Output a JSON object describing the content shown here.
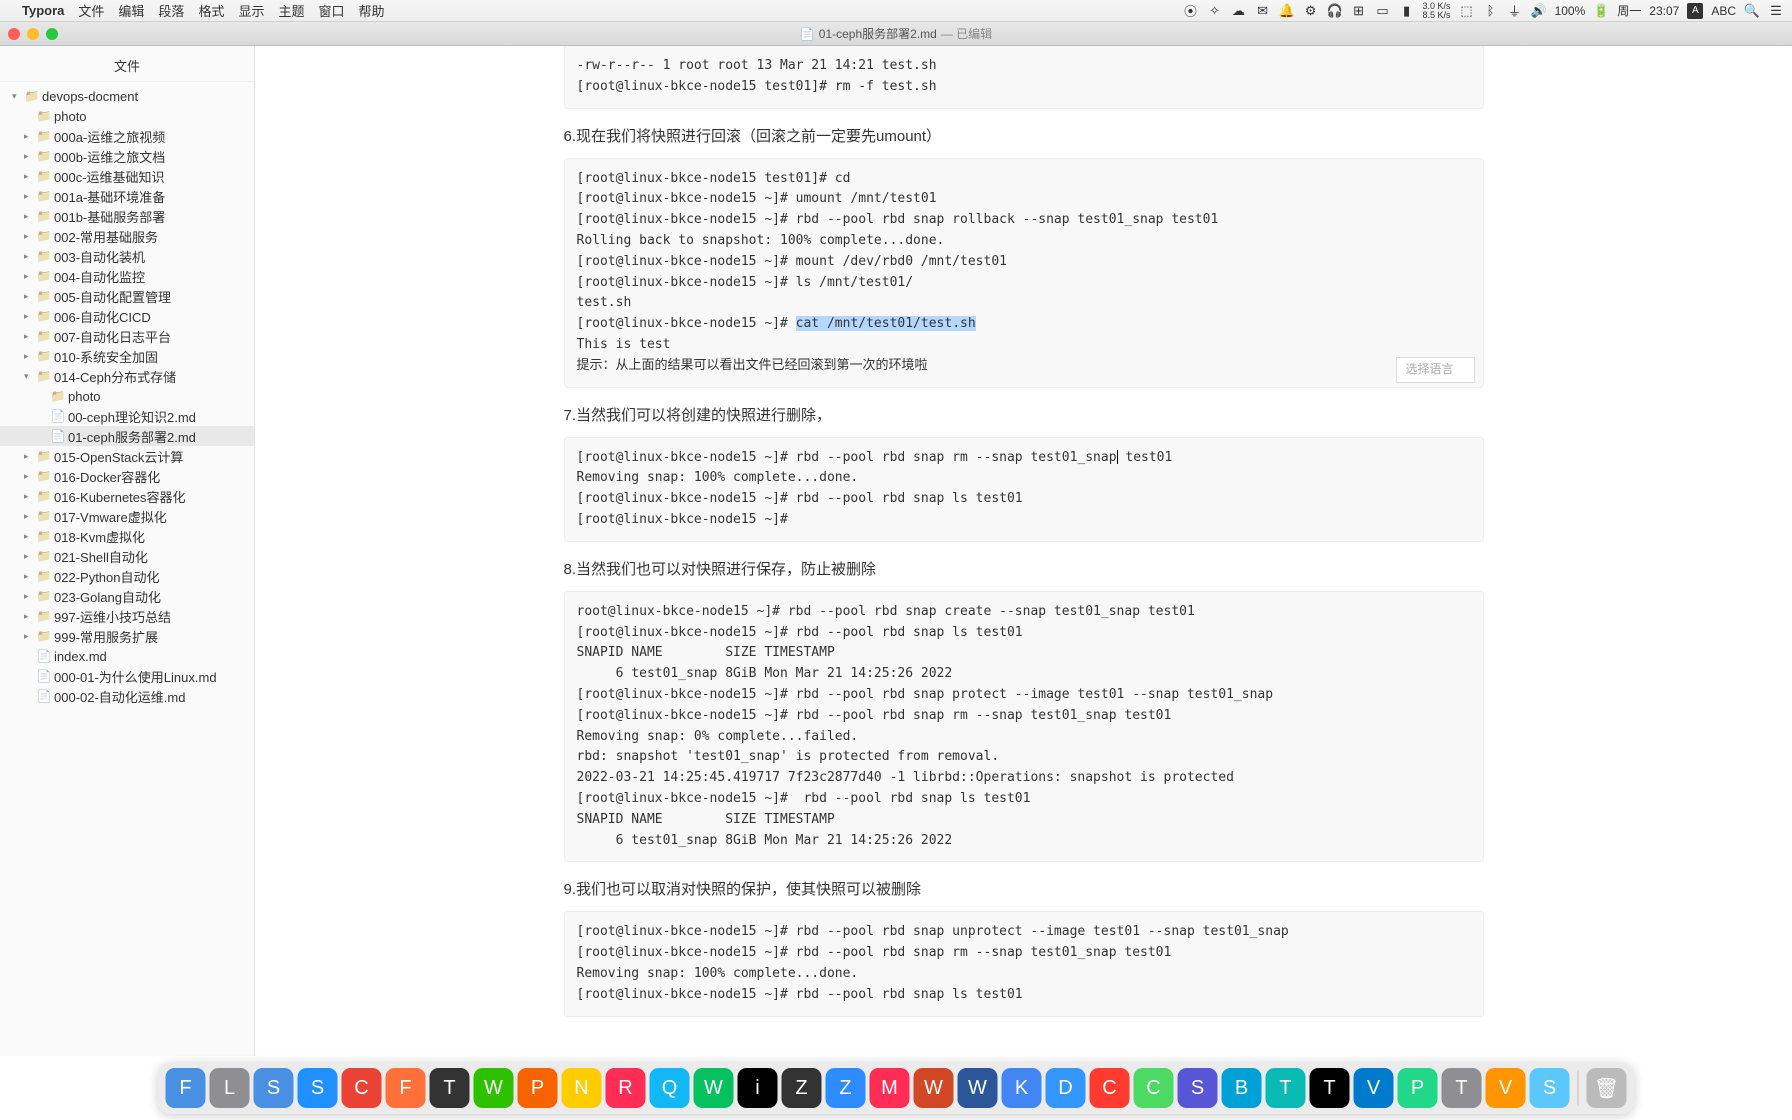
{
  "menubar": {
    "app": "Typora",
    "items": [
      "文件",
      "编辑",
      "段落",
      "格式",
      "显示",
      "主题",
      "窗口",
      "帮助"
    ],
    "right": {
      "net_up": "3.0 K/s",
      "net_dn": "8.5 K/s",
      "input": "A",
      "input2": "ABC",
      "battery": "100%",
      "day": "周一",
      "time": "23:07"
    }
  },
  "window": {
    "doc_title": "01-ceph服务部署2.md",
    "doc_status": "— 已编辑"
  },
  "sidebar": {
    "header": "文件",
    "root": "devops-docment",
    "items": [
      {
        "label": "photo",
        "type": "folder",
        "depth": 1,
        "expand": ""
      },
      {
        "label": "000a-运维之旅视频",
        "type": "folder",
        "depth": 1,
        "expand": "▸"
      },
      {
        "label": "000b-运维之旅文档",
        "type": "folder",
        "depth": 1,
        "expand": "▸"
      },
      {
        "label": "000c-运维基础知识",
        "type": "folder",
        "depth": 1,
        "expand": "▸"
      },
      {
        "label": "001a-基础环境准备",
        "type": "folder",
        "depth": 1,
        "expand": "▸"
      },
      {
        "label": "001b-基础服务部署",
        "type": "folder",
        "depth": 1,
        "expand": "▸"
      },
      {
        "label": "002-常用基础服务",
        "type": "folder",
        "depth": 1,
        "expand": "▸"
      },
      {
        "label": "003-自动化装机",
        "type": "folder",
        "depth": 1,
        "expand": "▸"
      },
      {
        "label": "004-自动化监控",
        "type": "folder",
        "depth": 1,
        "expand": "▸"
      },
      {
        "label": "005-自动化配置管理",
        "type": "folder",
        "depth": 1,
        "expand": "▸"
      },
      {
        "label": "006-自动化CICD",
        "type": "folder",
        "depth": 1,
        "expand": "▸"
      },
      {
        "label": "007-自动化日志平台",
        "type": "folder",
        "depth": 1,
        "expand": "▸"
      },
      {
        "label": "010-系统安全加固",
        "type": "folder",
        "depth": 1,
        "expand": "▸"
      },
      {
        "label": "014-Ceph分布式存储",
        "type": "folder",
        "depth": 1,
        "expand": "▾"
      },
      {
        "label": "photo",
        "type": "folder",
        "depth": 2,
        "expand": ""
      },
      {
        "label": "00-ceph理论知识2.md",
        "type": "file",
        "depth": 2
      },
      {
        "label": "01-ceph服务部署2.md",
        "type": "file",
        "depth": 2,
        "selected": true
      },
      {
        "label": "015-OpenStack云计算",
        "type": "folder",
        "depth": 1,
        "expand": "▸"
      },
      {
        "label": "016-Docker容器化",
        "type": "folder",
        "depth": 1,
        "expand": "▸"
      },
      {
        "label": "016-Kubernetes容器化",
        "type": "folder",
        "depth": 1,
        "expand": "▸"
      },
      {
        "label": "017-Vmware虚拟化",
        "type": "folder",
        "depth": 1,
        "expand": "▸"
      },
      {
        "label": "018-Kvm虚拟化",
        "type": "folder",
        "depth": 1,
        "expand": "▸"
      },
      {
        "label": "021-Shell自动化",
        "type": "folder",
        "depth": 1,
        "expand": "▸"
      },
      {
        "label": "022-Python自动化",
        "type": "folder",
        "depth": 1,
        "expand": "▸"
      },
      {
        "label": "023-Golang自动化",
        "type": "folder",
        "depth": 1,
        "expand": "▸"
      },
      {
        "label": "997-运维小技巧总结",
        "type": "folder",
        "depth": 1,
        "expand": "▸"
      },
      {
        "label": "999-常用服务扩展",
        "type": "folder",
        "depth": 1,
        "expand": "▸"
      },
      {
        "label": "index.md",
        "type": "file",
        "depth": 1
      },
      {
        "label": "000-01-为什么使用Linux.md",
        "type": "file",
        "depth": 1
      },
      {
        "label": "000-02-自动化运维.md",
        "type": "file",
        "depth": 1
      }
    ]
  },
  "doc": {
    "block0_top": "-rw-r--r-- 1 root root 13 Mar 21 14:21 test.sh\n[root@linux-bkce-node15 test01]# rm -f test.sh",
    "h6": "6.现在我们将快照进行回滚（回滚之前一定要先umount）",
    "block6_pre": "[root@linux-bkce-node15 test01]# cd\n[root@linux-bkce-node15 ~]# umount /mnt/test01\n[root@linux-bkce-node15 ~]# rbd --pool rbd snap rollback --snap test01_snap test01\nRolling back to snapshot: 100% complete...done.\n[root@linux-bkce-node15 ~]# mount /dev/rbd0 /mnt/test01\n[root@linux-bkce-node15 ~]# ls /mnt/test01/\ntest.sh\n[root@linux-bkce-node15 ~]# ",
    "block6_hl": "cat /mnt/test01/test.sh",
    "block6_post": "\nThis is test\n提示：从上面的结果可以看出文件已经回滚到第一次的环境啦",
    "lang_placeholder": "选择语言",
    "h7": "7.当然我们可以将创建的快照进行删除，",
    "block7_pre": "[root@linux-bkce-node15 ~]# rbd --pool rbd snap rm --snap test01_snap",
    "block7_cursor_tail": " test01\nRemoving snap: 100% complete...done.\n[root@linux-bkce-node15 ~]# rbd --pool rbd snap ls test01\n[root@linux-bkce-node15 ~]#",
    "h8": "8.当然我们也可以对快照进行保存，防止被删除",
    "block8": "root@linux-bkce-node15 ~]# rbd --pool rbd snap create --snap test01_snap test01\n[root@linux-bkce-node15 ~]# rbd --pool rbd snap ls test01\nSNAPID NAME        SIZE TIMESTAMP\n     6 test01_snap 8GiB Mon Mar 21 14:25:26 2022\n[root@linux-bkce-node15 ~]# rbd --pool rbd snap protect --image test01 --snap test01_snap\n[root@linux-bkce-node15 ~]# rbd --pool rbd snap rm --snap test01_snap test01\nRemoving snap: 0% complete...failed.\nrbd: snapshot 'test01_snap' is protected from removal.\n2022-03-21 14:25:45.419717 7f23c2877d40 -1 librbd::Operations: snapshot is protected\n[root@linux-bkce-node15 ~]#  rbd --pool rbd snap ls test01\nSNAPID NAME        SIZE TIMESTAMP\n     6 test01_snap 8GiB Mon Mar 21 14:25:26 2022",
    "h9": "9.我们也可以取消对快照的保护，使其快照可以被删除",
    "block9": "[root@linux-bkce-node15 ~]# rbd --pool rbd snap unprotect --image test01 --snap test01_snap\n[root@linux-bkce-node15 ~]# rbd --pool rbd snap rm --snap test01_snap test01\nRemoving snap: 100% complete...done.\n[root@linux-bkce-node15 ~]# rbd --pool rbd snap ls test01"
  },
  "dock": {
    "apps": [
      "Finder",
      "Launchpad",
      "Safari-alt",
      "Safari",
      "Chrome",
      "Firefox",
      "Typora",
      "WeChat",
      "Photos",
      "Notes",
      "Reminders",
      "QQ",
      "WeChat2",
      "iTerm",
      "ZTerm",
      "Zoom",
      "Music",
      "WPS",
      "WPS-W",
      "KMail",
      "DingTalk",
      "Calendar",
      "ClockApp",
      "Shield",
      "BiliPlay",
      "ToDesk",
      "Terminal",
      "VSCode",
      "PyCharm",
      "TextEdit",
      "VNC",
      "Snip"
    ],
    "trash": "Trash"
  }
}
